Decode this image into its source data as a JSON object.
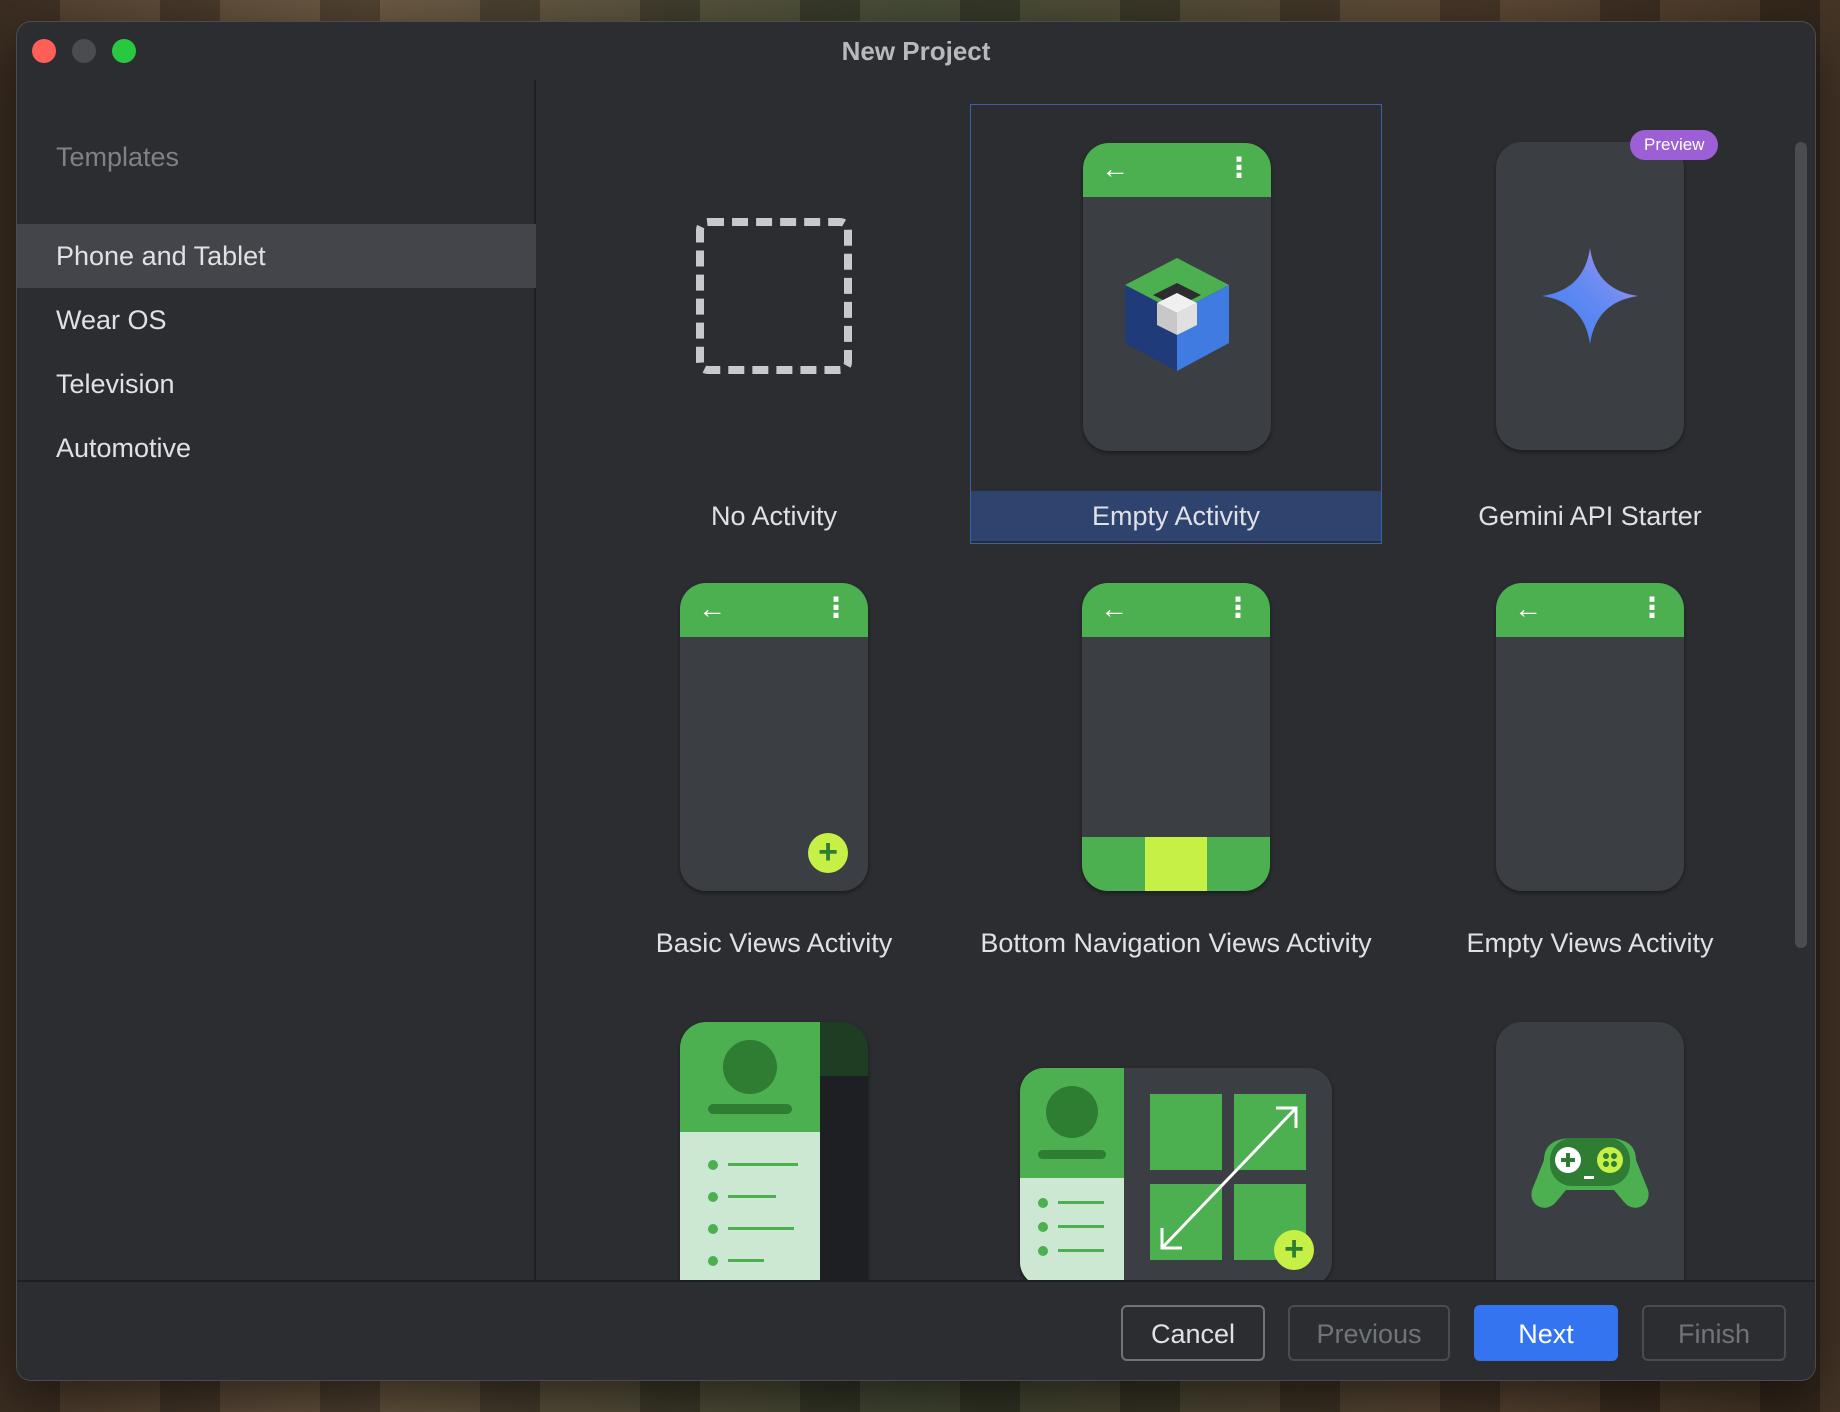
{
  "window": {
    "title": "New Project"
  },
  "sidebar": {
    "heading": "Templates",
    "items": [
      {
        "label": "Phone and Tablet",
        "selected": true
      },
      {
        "label": "Wear OS",
        "selected": false
      },
      {
        "label": "Television",
        "selected": false
      },
      {
        "label": "Automotive",
        "selected": false
      }
    ]
  },
  "templates": [
    {
      "label": "No Activity",
      "icon": "dashed-square-icon"
    },
    {
      "label": "Empty Activity",
      "icon": "compose-cube-icon",
      "selected": true
    },
    {
      "label": "Gemini API Starter",
      "icon": "gemini-sparkle-icon",
      "badge": "Preview"
    },
    {
      "label": "Basic Views Activity",
      "icon": "phone-fab-icon"
    },
    {
      "label": "Bottom Navigation Views Activity",
      "icon": "phone-bottom-nav-icon"
    },
    {
      "label": "Empty Views Activity",
      "icon": "phone-appbar-icon"
    },
    {
      "label": "",
      "icon": "navigation-drawer-icon"
    },
    {
      "label": "",
      "icon": "responsive-layout-icon"
    },
    {
      "label": "",
      "icon": "game-controller-icon"
    }
  ],
  "footer": {
    "cancel": "Cancel",
    "previous": "Previous",
    "next": "Next",
    "finish": "Finish"
  },
  "colors": {
    "accent": "#3574f0",
    "android_green": "#4caf50",
    "fab_lime": "#c6f046",
    "preview_badge": "#9c5fd6",
    "selection": "#2e436e"
  }
}
